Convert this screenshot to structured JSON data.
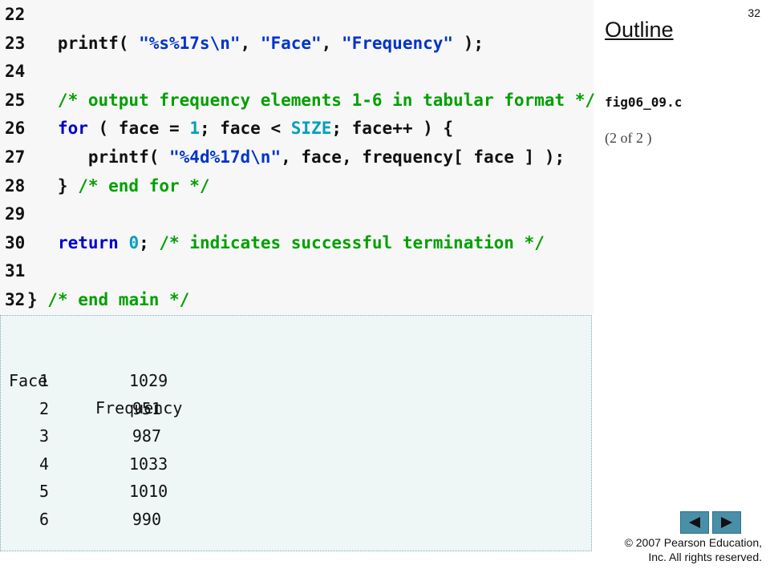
{
  "slide": {
    "page_number": "32",
    "outline_title": "Outline",
    "filename": "fig06_09.c",
    "page_info": "(2 of 2 )",
    "copyright_line1": "© 2007 Pearson Education,",
    "copyright_line2": "Inc.  All rights reserved."
  },
  "code_lines": [
    {
      "num": "22",
      "segments": []
    },
    {
      "num": "23",
      "segments": [
        {
          "t": "   printf( ",
          "c": "plain"
        },
        {
          "t": "\"%s%17s\\n\"",
          "c": "string"
        },
        {
          "t": ", ",
          "c": "plain"
        },
        {
          "t": "\"Face\"",
          "c": "string"
        },
        {
          "t": ", ",
          "c": "plain"
        },
        {
          "t": "\"Frequency\"",
          "c": "string"
        },
        {
          "t": " );",
          "c": "plain"
        }
      ]
    },
    {
      "num": "24",
      "segments": []
    },
    {
      "num": "25",
      "segments": [
        {
          "t": "   /* output frequency elements 1-6 in tabular format */",
          "c": "comment"
        }
      ]
    },
    {
      "num": "26",
      "segments": [
        {
          "t": "   ",
          "c": "plain"
        },
        {
          "t": "for",
          "c": "keyword"
        },
        {
          "t": " ( face = ",
          "c": "plain"
        },
        {
          "t": "1",
          "c": "number"
        },
        {
          "t": "; face < ",
          "c": "plain"
        },
        {
          "t": "SIZE",
          "c": "number"
        },
        {
          "t": "; face++ ) {",
          "c": "plain"
        }
      ]
    },
    {
      "num": "27",
      "segments": [
        {
          "t": "      printf( ",
          "c": "plain"
        },
        {
          "t": "\"%4d%17d\\n\"",
          "c": "string"
        },
        {
          "t": ", face, frequency[ face ] );",
          "c": "plain"
        }
      ]
    },
    {
      "num": "28",
      "segments": [
        {
          "t": "   } ",
          "c": "plain"
        },
        {
          "t": "/* end for */",
          "c": "comment"
        }
      ]
    },
    {
      "num": "29",
      "segments": []
    },
    {
      "num": "30",
      "segments": [
        {
          "t": "   ",
          "c": "plain"
        },
        {
          "t": "return",
          "c": "keyword"
        },
        {
          "t": " ",
          "c": "plain"
        },
        {
          "t": "0",
          "c": "number"
        },
        {
          "t": "; ",
          "c": "plain"
        },
        {
          "t": "/* indicates successful termination */",
          "c": "comment"
        }
      ]
    },
    {
      "num": "31",
      "segments": []
    },
    {
      "num": "32",
      "segments": [
        {
          "t": "} ",
          "c": "plain"
        },
        {
          "t": "/* end main */",
          "c": "comment"
        }
      ]
    }
  ],
  "output": {
    "header_face": "Face",
    "header_frequency": "Frequency",
    "rows": [
      {
        "face": "1",
        "frequency": "1029"
      },
      {
        "face": "2",
        "frequency": "951"
      },
      {
        "face": "3",
        "frequency": "987"
      },
      {
        "face": "4",
        "frequency": "1033"
      },
      {
        "face": "5",
        "frequency": "1010"
      },
      {
        "face": "6",
        "frequency": "990"
      }
    ]
  },
  "nav": {
    "prev_icon": "triangle-left-icon",
    "next_icon": "triangle-right-icon"
  },
  "colors": {
    "keyword": "#0000cc",
    "comment": "#00a000",
    "string": "#0033cc",
    "number": "#00a0c0",
    "nav_button": "#4a8fa8"
  }
}
